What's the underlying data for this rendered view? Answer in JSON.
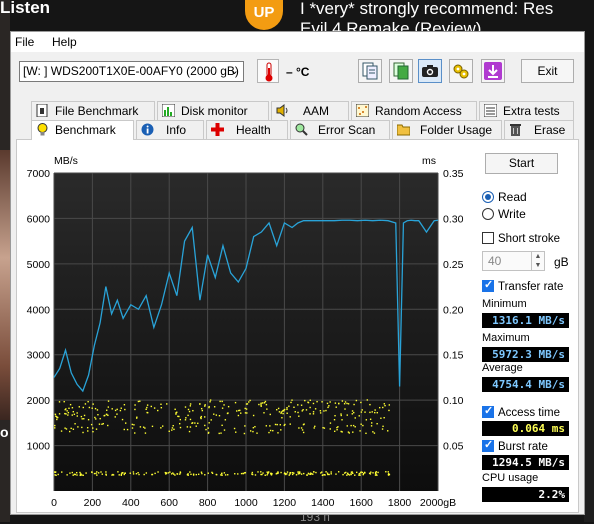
{
  "background": {
    "left_text": "Listen",
    "logo": "UP",
    "headline_line1": "I *very* strongly recommend: Res",
    "headline_line2": "Evil 4 Remake (Review)",
    "left_letter": "o",
    "bottom_text": "193 п"
  },
  "menu": {
    "file": "File",
    "help": "Help"
  },
  "toolbar": {
    "drive": "[W: ] WDS200T1X0E-00AFY0 (2000 gB)",
    "temperature": "– °C",
    "exit_label": "Exit",
    "icons": [
      "copy-info-icon",
      "copy-text-icon",
      "camera-icon",
      "options-icon",
      "download-icon"
    ]
  },
  "tabs_row1": [
    {
      "label": "File Benchmark",
      "icon": "file-benchmark-icon"
    },
    {
      "label": "Disk monitor",
      "icon": "disk-monitor-icon"
    },
    {
      "label": "AAM",
      "icon": "speaker-icon"
    },
    {
      "label": "Random Access",
      "icon": "random-access-icon"
    },
    {
      "label": "Extra tests",
      "icon": "extra-tests-icon"
    }
  ],
  "tabs_row2": [
    {
      "label": "Benchmark",
      "icon": "bulb-icon",
      "active": true
    },
    {
      "label": "Info",
      "icon": "info-icon"
    },
    {
      "label": "Health",
      "icon": "health-icon"
    },
    {
      "label": "Error Scan",
      "icon": "magnifier-icon"
    },
    {
      "label": "Folder Usage",
      "icon": "folder-icon"
    },
    {
      "label": "Erase",
      "icon": "trash-icon"
    }
  ],
  "controls": {
    "start_label": "Start",
    "read_label": "Read",
    "write_label": "Write",
    "short_stroke_label": "Short stroke",
    "short_stroke_value": "40",
    "short_stroke_unit": "gB",
    "transfer_rate_label": "Transfer rate",
    "minimum_label": "Minimum",
    "minimum_value": "1316.1 MB/s",
    "maximum_label": "Maximum",
    "maximum_value": "5972.3 MB/s",
    "average_label": "Average",
    "average_value": "4754.4 MB/s",
    "access_time_label": "Access time",
    "access_time_value": "0.064 ms",
    "burst_rate_label": "Burst rate",
    "burst_rate_value": "1294.5 MB/s",
    "cpu_usage_label": "CPU usage",
    "cpu_usage_value": "2.2%"
  },
  "chart_data": {
    "type": "line",
    "ylabel_left": "MB/s",
    "ylabel_right": "ms",
    "xlim": [
      0,
      2000
    ],
    "ylim_left": [
      0,
      7000
    ],
    "ylim_right": [
      0,
      0.35
    ],
    "x_ticks": [
      "0",
      "200",
      "400",
      "600",
      "800",
      "1000",
      "1200",
      "1400",
      "1600",
      "1800",
      "2000gB"
    ],
    "y_ticks_left": [
      "7000",
      "6000",
      "5000",
      "4000",
      "3000",
      "2000",
      "1000"
    ],
    "y_ticks_right": [
      "0.35",
      "0.30",
      "0.25",
      "0.20",
      "0.15",
      "0.10",
      "0.05"
    ],
    "grid": true,
    "series": [
      {
        "color": "#29a3d8",
        "x": [
          0,
          30,
          60,
          90,
          120,
          150,
          180,
          210,
          240,
          270,
          300,
          330,
          360,
          400,
          440,
          480,
          520,
          560,
          600,
          640,
          680,
          720,
          760,
          800,
          840,
          880,
          920,
          960,
          1000,
          1040,
          1080,
          1120,
          1160,
          1200,
          1240,
          1270,
          1300,
          1340,
          1380,
          1420,
          1460,
          1500,
          1540,
          1580,
          1620,
          1660,
          1700,
          1740,
          1780,
          1800,
          1820,
          1840,
          1860,
          1880,
          1900,
          1940,
          1980,
          2000
        ],
        "values": [
          2500,
          2700,
          3100,
          2600,
          2350,
          2200,
          2550,
          3200,
          3700,
          4500,
          3900,
          4200,
          3800,
          4100,
          4000,
          4300,
          3600,
          4100,
          4800,
          4300,
          5500,
          5800,
          4200,
          5200,
          4700,
          5400,
          4800,
          4600,
          4900,
          5600,
          5700,
          5900,
          5400,
          5900,
          5800,
          5900,
          5950,
          5950,
          5950,
          5950,
          5950,
          5960,
          5960,
          5950,
          5960,
          5950,
          5960,
          5950,
          5900,
          2300,
          5900,
          5950,
          5960,
          5950,
          5950,
          5700,
          5950,
          5960
        ]
      }
    ],
    "access_time_scatter": {
      "color": "#ffff33",
      "bands_ms": [
        0.02,
        0.095,
        0.085,
        0.07
      ]
    }
  }
}
